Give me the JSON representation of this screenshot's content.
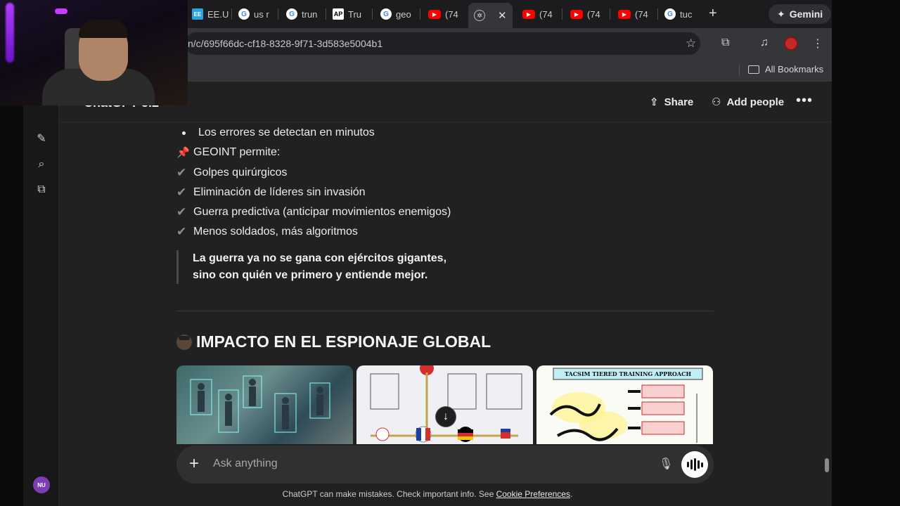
{
  "browser": {
    "tabs": [
      {
        "label": "EE.U",
        "favicon": "ee"
      },
      {
        "label": "us r",
        "favicon": "google"
      },
      {
        "label": "trun",
        "favicon": "google"
      },
      {
        "label": "Tru",
        "favicon": "ap"
      },
      {
        "label": "geo",
        "favicon": "google"
      },
      {
        "label": "(74",
        "favicon": "youtube"
      },
      {
        "label": "",
        "favicon": "chatgpt",
        "active": true
      },
      {
        "label": "(74",
        "favicon": "youtube"
      },
      {
        "label": "(74",
        "favicon": "youtube"
      },
      {
        "label": "(74",
        "favicon": "youtube"
      },
      {
        "label": "tuc",
        "favicon": "google"
      }
    ],
    "gemini_label": "Gemini",
    "url": "n/c/695f66dc-cf18-8328-9f71-3d583e5004b1",
    "all_bookmarks": "All Bookmarks"
  },
  "chat": {
    "model_name": "ChatGPT 5.2",
    "share_label": "Share",
    "add_people_label": "Add people",
    "user_initials": "NU",
    "bullet": "Los errores se detectan en minutos",
    "geoint_title": "GEOINT permite:",
    "checks": [
      "Golpes quirúrgicos",
      "Eliminación de líderes sin invasión",
      "Guerra predictiva (anticipar movimientos enemigos)",
      "Menos soldados, más algoritmos"
    ],
    "quote_line1": "La guerra ya no se gana con ejércitos gigantes,",
    "quote_line2": "sino con quién ve primero y entiende mejor.",
    "heading": "IMPACTO EN EL ESPIONAJE GLOBAL",
    "image3_caption": "TACSIM TIERED TRAINING APPROACH",
    "composer_placeholder": "Ask anything",
    "disclaimer_prefix": "ChatGPT can make mistakes. Check important info. See ",
    "disclaimer_link": "Cookie Preferences",
    "disclaimer_suffix": "."
  }
}
